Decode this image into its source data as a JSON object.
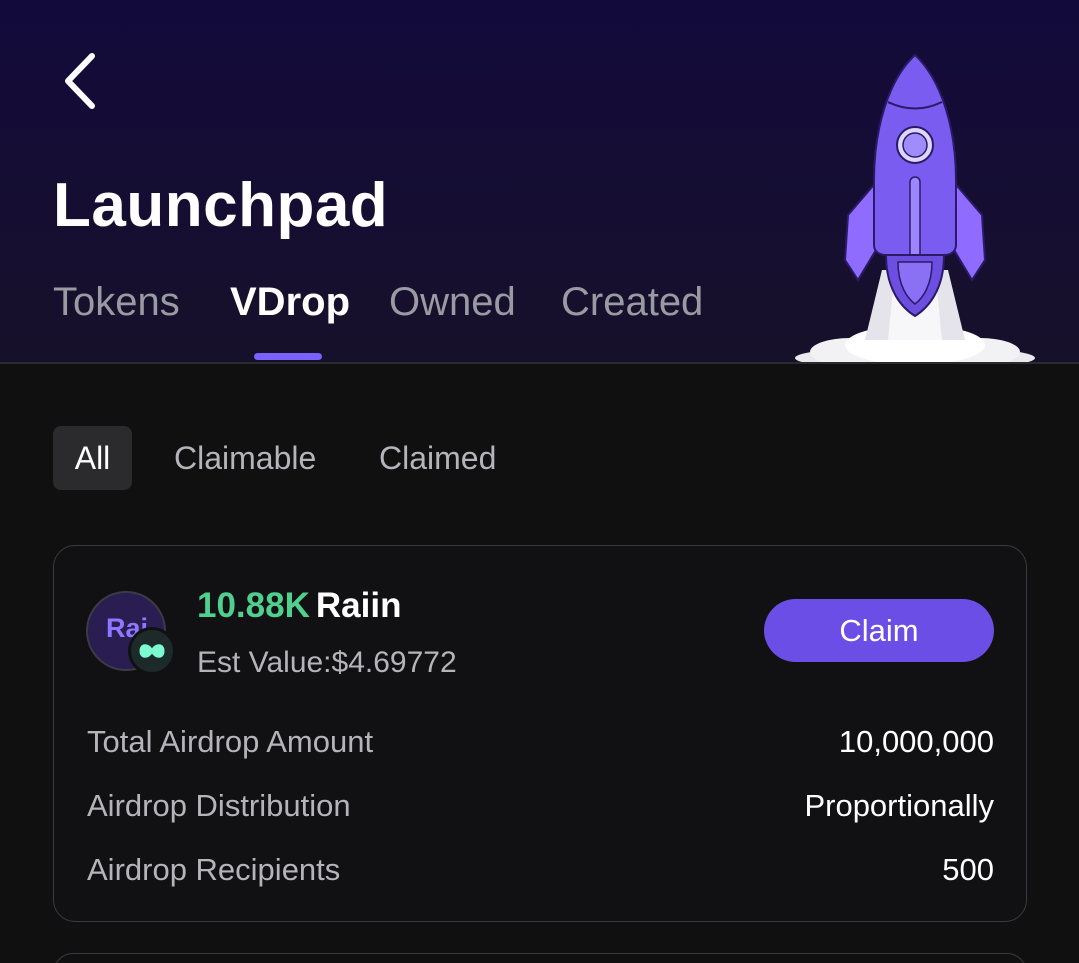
{
  "header": {
    "title": "Launchpad",
    "back_icon": "chevron-left-icon",
    "illustration": "rocket-icon"
  },
  "tabs": [
    {
      "label": "Tokens",
      "active": false
    },
    {
      "label": "VDrop",
      "active": true
    },
    {
      "label": "Owned",
      "active": false
    },
    {
      "label": "Created",
      "active": false
    }
  ],
  "filters": [
    {
      "label": "All",
      "active": true
    },
    {
      "label": "Claimable",
      "active": false
    },
    {
      "label": "Claimed",
      "active": false
    }
  ],
  "airdrop_card": {
    "avatar_text": "Rai",
    "amount": "10.88K",
    "token_symbol": "Raiin",
    "est_value": "Est Value:$4.69772",
    "claim_label": "Claim",
    "details": [
      {
        "label": "Total Airdrop Amount",
        "value": "10,000,000"
      },
      {
        "label": "Airdrop Distribution",
        "value": "Proportionally"
      },
      {
        "label": "Airdrop Recipients",
        "value": "500"
      }
    ]
  },
  "colors": {
    "accent": "#7b61ff",
    "button": "#6b4ee6",
    "amount_green": "#4fd08e",
    "background": "#101010",
    "header_top": "#120a3a"
  }
}
